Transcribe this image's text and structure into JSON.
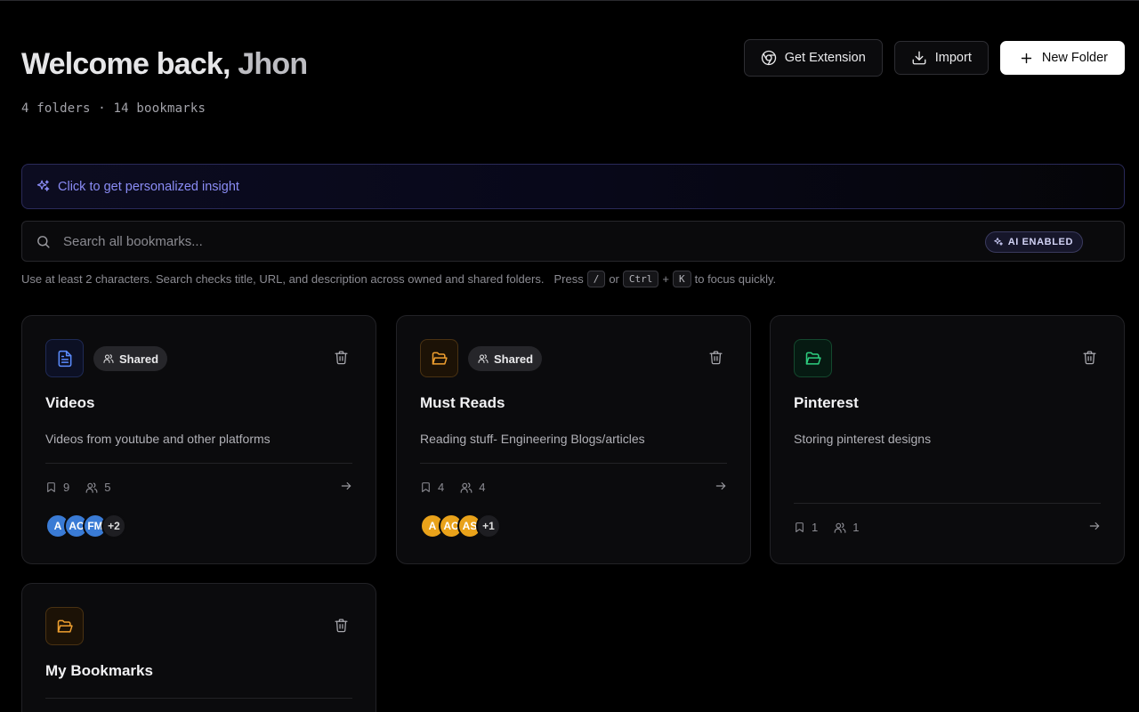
{
  "header": {
    "title_prefix": "Welcome back, ",
    "user_name": "Jhon",
    "summary": "4 folders · 14 bookmarks"
  },
  "actions": {
    "extension_label": "Get Extension",
    "import_label": "Import",
    "new_folder_label": "New Folder"
  },
  "insight": {
    "label": "Click to get personalized insight"
  },
  "search": {
    "placeholder": "Search all bookmarks...",
    "badge": "AI ENABLED",
    "hint_text": "Use at least 2 characters. Search checks title, URL, and description across owned and shared folders.",
    "hint_press": "Press",
    "key_slash": "/",
    "hint_or": "or",
    "key_ctrl": "Ctrl",
    "hint_plus": "+",
    "key_k": "K",
    "hint_end": "to focus quickly."
  },
  "folders": [
    {
      "title": "Videos",
      "description": "Videos from youtube and other platforms",
      "shared_label": "Shared",
      "bookmarks": "9",
      "members": "5",
      "avatars": [
        "A",
        "AC",
        "FM"
      ],
      "more": "+2",
      "icon": "file-text-icon",
      "accent": "#5b8cff"
    },
    {
      "title": "Must Reads",
      "description": "Reading stuff- Engineering Blogs/articles",
      "shared_label": "Shared",
      "bookmarks": "4",
      "members": "4",
      "avatars": [
        "A",
        "AC",
        "AS"
      ],
      "more": "+1",
      "icon": "folder-open-icon",
      "accent": "#f0a030"
    },
    {
      "title": "Pinterest",
      "description": "Storing pinterest designs",
      "bookmarks": "1",
      "members": "1",
      "icon": "folder-open-icon",
      "accent": "#2ecf80"
    },
    {
      "title": "My Bookmarks",
      "icon": "folder-open-icon",
      "accent": "#f0a030"
    }
  ]
}
